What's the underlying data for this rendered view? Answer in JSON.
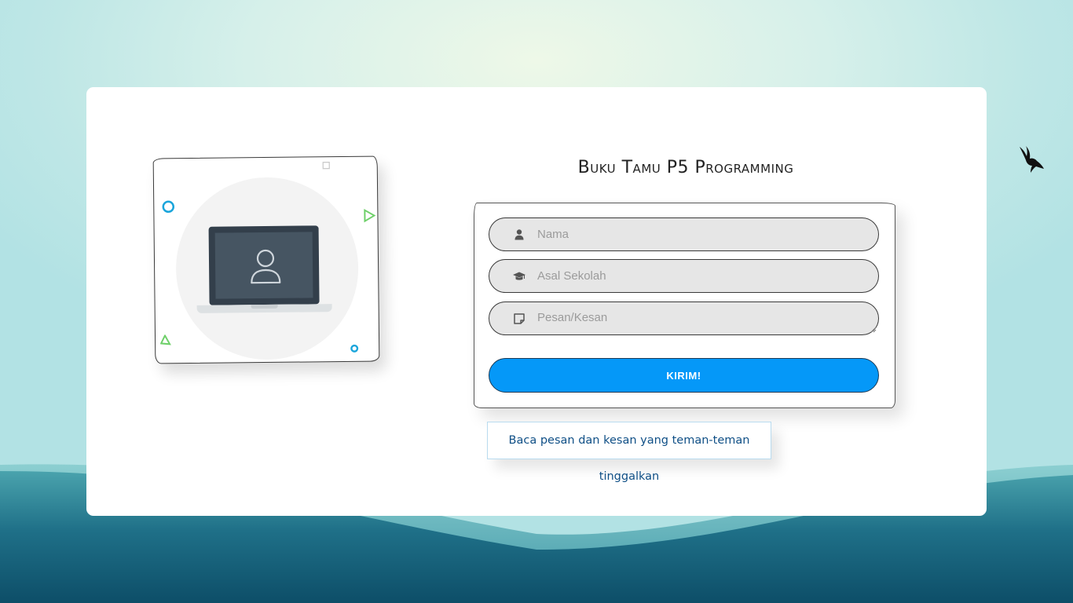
{
  "page": {
    "title": "Buku Tamu P5 Programming"
  },
  "form": {
    "name_placeholder": "Nama",
    "school_placeholder": "Asal Sekolah",
    "message_placeholder": "Pesan/Kesan",
    "submit_label": "KIRIM!"
  },
  "link": {
    "read_messages": "Baca pesan dan kesan yang teman-teman tinggalkan"
  },
  "icons": {
    "name": "user-icon",
    "school": "graduation-cap-icon",
    "message": "sticky-note-icon",
    "illustration": "laptop-user-icon",
    "decor": "bird-icon"
  },
  "colors": {
    "accent": "#0598f8",
    "link": "#0f4f86",
    "sea": "#1e6f86"
  }
}
